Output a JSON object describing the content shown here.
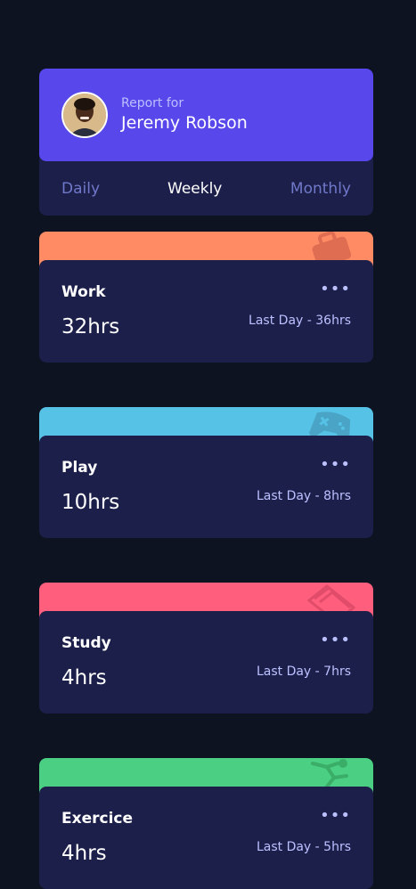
{
  "profile": {
    "report_for": "Report for",
    "name": "Jeremy Robson"
  },
  "tabs": [
    {
      "label": "Daily",
      "active": false
    },
    {
      "label": "Weekly",
      "active": true
    },
    {
      "label": "Monthly",
      "active": false
    }
  ],
  "more_icon": "•••",
  "cards": [
    {
      "title": "Work",
      "hours": "32hrs",
      "previous": "Last Day - 36hrs",
      "color": "#ff8b64",
      "icon": "briefcase-icon"
    },
    {
      "title": "Play",
      "hours": "10hrs",
      "previous": "Last Day - 8hrs",
      "color": "#55c2e6",
      "icon": "gamepad-icon"
    },
    {
      "title": "Study",
      "hours": "4hrs",
      "previous": "Last Day - 7hrs",
      "color": "#ff5e7d",
      "icon": "books-icon"
    },
    {
      "title": "Exercice",
      "hours": "4hrs",
      "previous": "Last Day - 5hrs",
      "color": "#4bcf82",
      "icon": "runner-icon"
    }
  ]
}
